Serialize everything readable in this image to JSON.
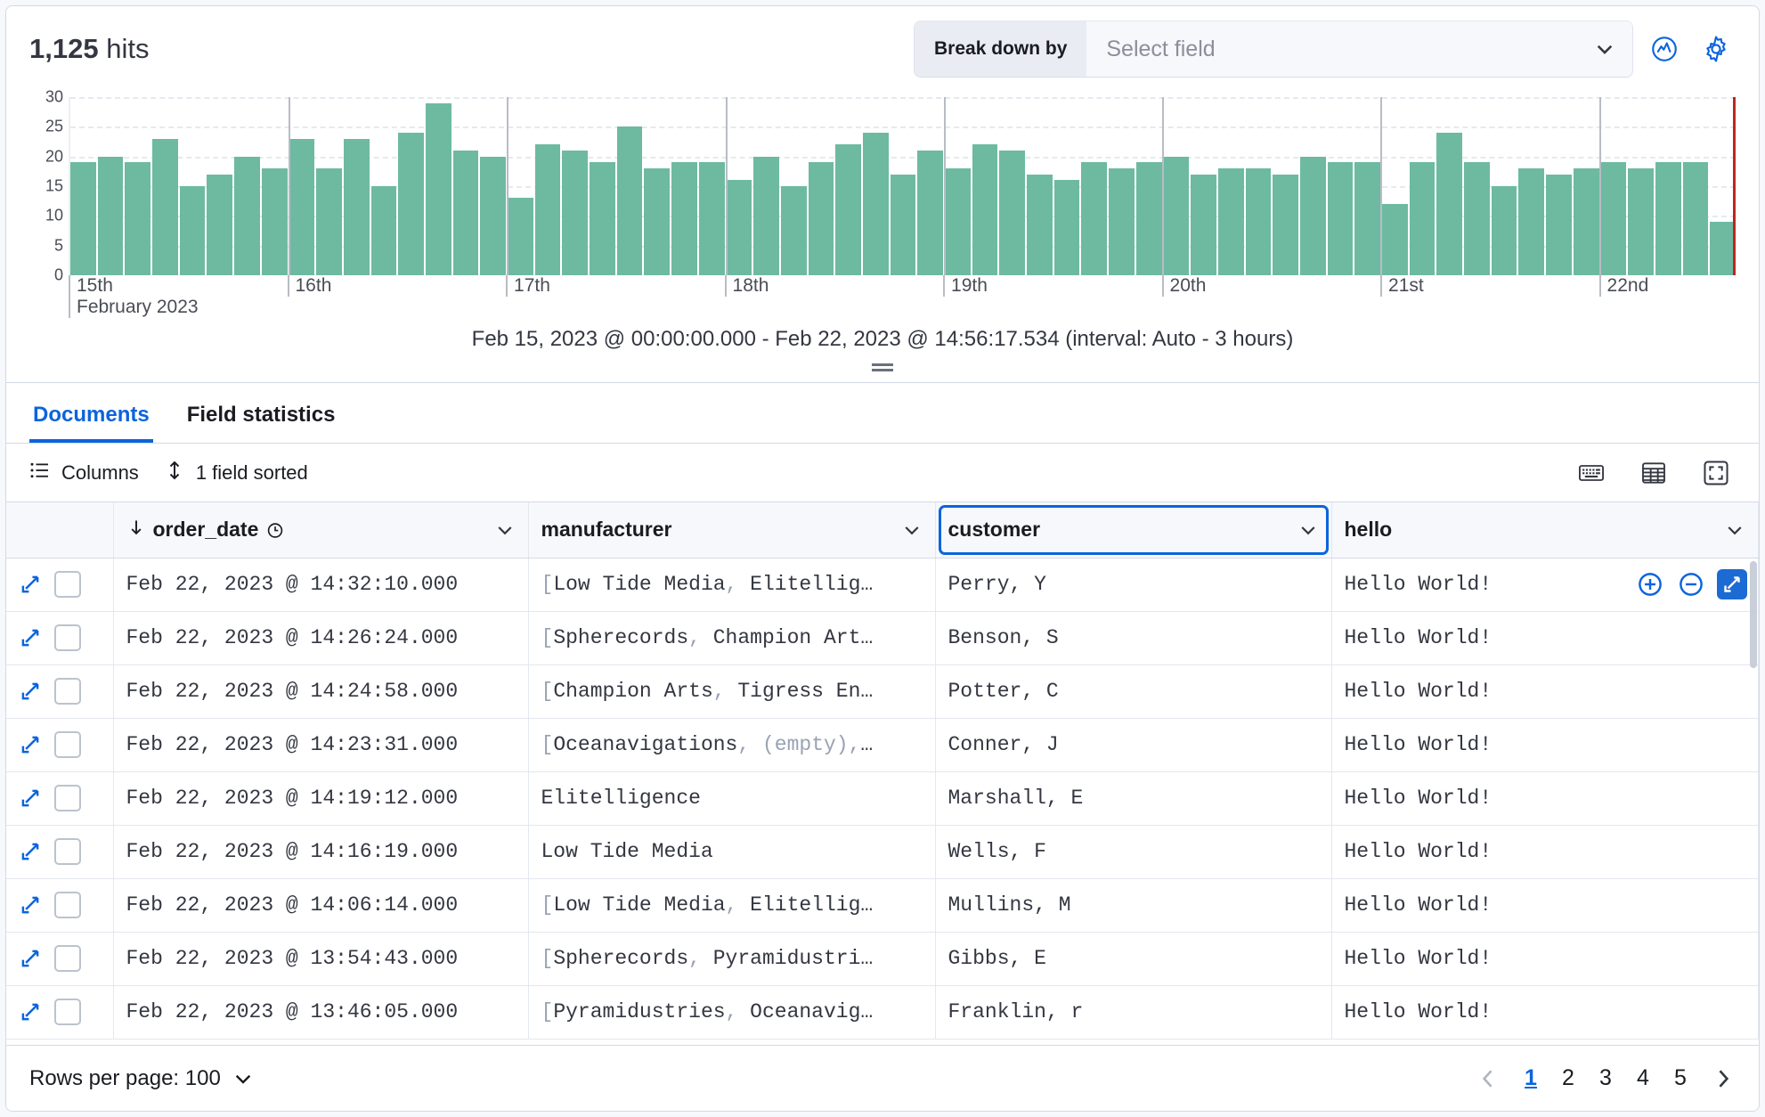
{
  "header": {
    "hits_count": "1,125",
    "hits_label": "hits",
    "breakdown_label": "Break down by",
    "breakdown_placeholder": "Select field",
    "chart_options_icon": "chart-options-icon",
    "settings_icon": "gear-icon"
  },
  "chart_caption": "Feb 15, 2023 @ 00:00:00.000 - Feb 22, 2023 @ 14:56:17.534 (interval: Auto - 3 hours)",
  "chart_data": {
    "type": "bar",
    "title": "",
    "xlabel": "",
    "ylabel": "",
    "ylim": [
      0,
      30
    ],
    "yticks": [
      0,
      5,
      10,
      15,
      20,
      25,
      30
    ],
    "grid": true,
    "legend": "none",
    "interval": "3 hours",
    "x_tick_labels": [
      "15th",
      "16th",
      "17th",
      "18th",
      "19th",
      "20th",
      "21st",
      "22nd"
    ],
    "x_axis_subtitle": "February 2023",
    "range_start": "Feb 15, 2023 @ 00:00:00.000",
    "range_end": "Feb 22, 2023 @ 14:56:17.534",
    "bar_color": "#6dbaa1",
    "end_marker_color": "#bd271e",
    "categories": [
      "Feb 15 00:00",
      "Feb 15 03:00",
      "Feb 15 06:00",
      "Feb 15 09:00",
      "Feb 15 12:00",
      "Feb 15 15:00",
      "Feb 15 18:00",
      "Feb 15 21:00",
      "Feb 16 00:00",
      "Feb 16 03:00",
      "Feb 16 06:00",
      "Feb 16 09:00",
      "Feb 16 12:00",
      "Feb 16 15:00",
      "Feb 16 18:00",
      "Feb 16 21:00",
      "Feb 17 00:00",
      "Feb 17 03:00",
      "Feb 17 06:00",
      "Feb 17 09:00",
      "Feb 17 12:00",
      "Feb 17 15:00",
      "Feb 17 18:00",
      "Feb 17 21:00",
      "Feb 18 00:00",
      "Feb 18 03:00",
      "Feb 18 06:00",
      "Feb 18 09:00",
      "Feb 18 12:00",
      "Feb 18 15:00",
      "Feb 18 18:00",
      "Feb 18 21:00",
      "Feb 19 00:00",
      "Feb 19 03:00",
      "Feb 19 06:00",
      "Feb 19 09:00",
      "Feb 19 12:00",
      "Feb 19 15:00",
      "Feb 19 18:00",
      "Feb 19 21:00",
      "Feb 20 00:00",
      "Feb 20 03:00",
      "Feb 20 06:00",
      "Feb 20 09:00",
      "Feb 20 12:00",
      "Feb 20 15:00",
      "Feb 20 18:00",
      "Feb 20 21:00",
      "Feb 21 00:00",
      "Feb 21 03:00",
      "Feb 21 06:00",
      "Feb 21 09:00",
      "Feb 21 12:00",
      "Feb 21 15:00",
      "Feb 21 18:00",
      "Feb 21 21:00",
      "Feb 22 00:00",
      "Feb 22 03:00",
      "Feb 22 06:00",
      "Feb 22 09:00",
      "Feb 22 12:00"
    ],
    "values": [
      19,
      20,
      19,
      23,
      15,
      17,
      20,
      18,
      23,
      18,
      23,
      15,
      24,
      29,
      21,
      20,
      13,
      22,
      21,
      19,
      25,
      18,
      19,
      19,
      16,
      20,
      15,
      19,
      22,
      24,
      17,
      21,
      18,
      22,
      21,
      17,
      16,
      19,
      18,
      19,
      20,
      17,
      18,
      18,
      17,
      20,
      19,
      19,
      12,
      19,
      24,
      19,
      15,
      18,
      17,
      18,
      19,
      18,
      19,
      19,
      9
    ]
  },
  "tabs": [
    {
      "label": "Documents",
      "active": true
    },
    {
      "label": "Field statistics",
      "active": false
    }
  ],
  "toolbar": {
    "columns_label": "Columns",
    "sort_label": "1 field sorted",
    "columns_icon": "list-icon",
    "sort_icon": "sort-updown-icon",
    "keyboard_icon": "keyboard-icon",
    "density_icon": "table-density-icon",
    "fullscreen_icon": "fullscreen-icon"
  },
  "grid": {
    "columns": [
      {
        "name": "order_date",
        "sorted": "desc",
        "type_icon": "clock-icon",
        "focused": false
      },
      {
        "name": "manufacturer",
        "focused": false
      },
      {
        "name": "customer",
        "focused": true
      },
      {
        "name": "hello",
        "focused": false
      }
    ],
    "rows": [
      {
        "order_date": "Feb 22, 2023 @ 14:32:10.000",
        "manufacturer": "[Low Tide Media, Elitellig…",
        "manufacturer_bracket": true,
        "customer": "Perry, Y",
        "hello": "Hello World!"
      },
      {
        "order_date": "Feb 22, 2023 @ 14:26:24.000",
        "manufacturer": "[Spherecords, Champion Art…",
        "manufacturer_bracket": true,
        "customer": "Benson, S",
        "hello": "Hello World!"
      },
      {
        "order_date": "Feb 22, 2023 @ 14:24:58.000",
        "manufacturer": "[Champion Arts, Tigress En…",
        "manufacturer_bracket": true,
        "customer": "Potter, C",
        "hello": "Hello World!"
      },
      {
        "order_date": "Feb 22, 2023 @ 14:23:31.000",
        "manufacturer": "[Oceanavigations, (empty),…",
        "manufacturer_bracket": true,
        "customer": "Conner, J",
        "hello": "Hello World!"
      },
      {
        "order_date": "Feb 22, 2023 @ 14:19:12.000",
        "manufacturer": "Elitelligence",
        "manufacturer_bracket": false,
        "customer": "Marshall, E",
        "hello": "Hello World!"
      },
      {
        "order_date": "Feb 22, 2023 @ 14:16:19.000",
        "manufacturer": "Low Tide Media",
        "manufacturer_bracket": false,
        "customer": "Wells, F",
        "hello": "Hello World!"
      },
      {
        "order_date": "Feb 22, 2023 @ 14:06:14.000",
        "manufacturer": "[Low Tide Media, Elitellig…",
        "manufacturer_bracket": true,
        "customer": "Mullins, M",
        "hello": "Hello World!"
      },
      {
        "order_date": "Feb 22, 2023 @ 13:54:43.000",
        "manufacturer": "[Spherecords, Pyramidustri…",
        "manufacturer_bracket": true,
        "customer": "Gibbs, E",
        "hello": "Hello World!"
      },
      {
        "order_date": "Feb 22, 2023 @ 13:46:05.000",
        "manufacturer": "[Pyramidustries, Oceanavig…",
        "manufacturer_bracket": true,
        "customer": "Franklin, r",
        "hello": "Hello World!"
      }
    ],
    "row_actions": {
      "filter_for_icon": "plus-circle-icon",
      "filter_out_icon": "minus-circle-icon",
      "expand_icon": "expand-icon"
    }
  },
  "footer": {
    "rows_per_page_label": "Rows per page: 100",
    "pages": [
      "1",
      "2",
      "3",
      "4",
      "5"
    ],
    "current_page": "1",
    "prev_icon": "chevron-left-icon",
    "next_icon": "chevron-right-icon"
  }
}
